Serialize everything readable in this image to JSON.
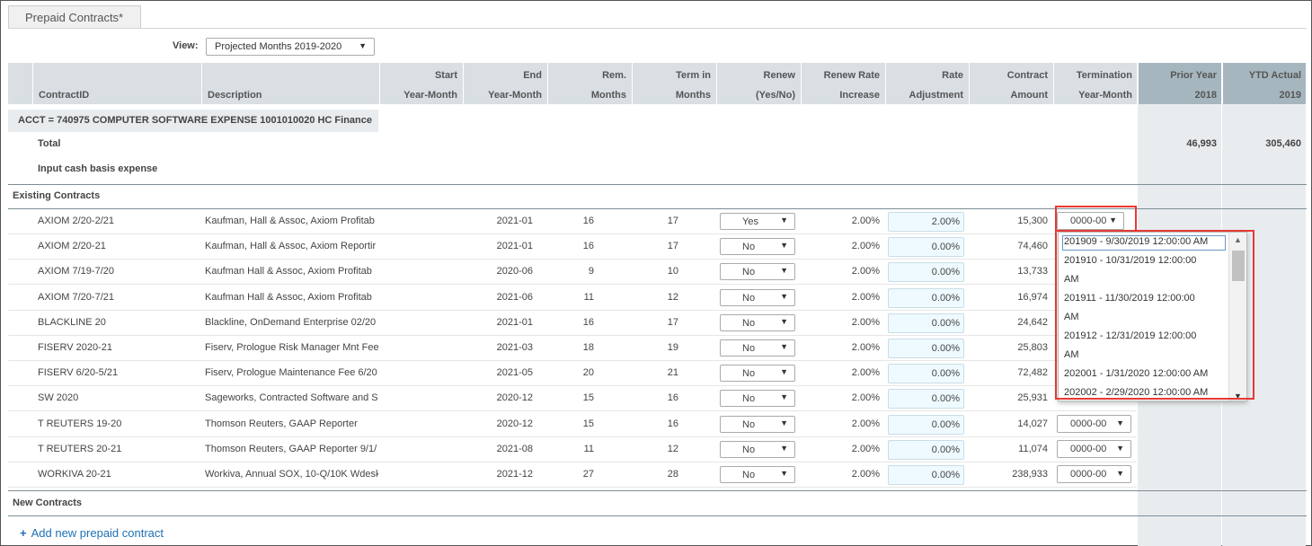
{
  "tab": {
    "label": "Prepaid Contracts*"
  },
  "view": {
    "label": "View:",
    "value": "Projected  Months 2019-2020"
  },
  "headers": {
    "contract_id": "ContractID",
    "description": "Description",
    "start_1": "Start",
    "start_2": "Year-Month",
    "end_1": "End",
    "end_2": "Year-Month",
    "rem_1": "Rem.",
    "rem_2": "Months",
    "term_1": "Term in",
    "term_2": "Months",
    "renew_1": "Renew",
    "renew_2": "(Yes/No)",
    "rri_1": "Renew Rate",
    "rri_2": "Increase",
    "adj_1": "Rate",
    "adj_2": "Adjustment",
    "amt_1": "Contract",
    "amt_2": "Amount",
    "tym_1": "Termination",
    "tym_2": "Year-Month",
    "prior_1": "Prior Year",
    "prior_2": "2018",
    "ytd_1": "YTD Actual",
    "ytd_2": "2019"
  },
  "account": {
    "title": "ACCT = 740975 COMPUTER SOFTWARE EXPENSE 1001010020 HC Finance",
    "total_label": "Total",
    "total_prior": "46,993",
    "total_ytd": "305,460",
    "input_label": "Input cash basis expense"
  },
  "sections": {
    "existing": "Existing Contracts",
    "new": "New Contracts"
  },
  "rows": [
    {
      "id": "AXIOM 2/20-2/21",
      "desc": "Kaufman, Hall & Assoc, Axiom Profitab",
      "end": "2021-01",
      "rem": "16",
      "term": "17",
      "renew": "Yes",
      "rri": "2.00%",
      "adj": "2.00%",
      "amt": "15,300",
      "tym": "0000-00"
    },
    {
      "id": "AXIOM 2/20-21",
      "desc": "Kaufman, Hall & Assoc, Axiom Reportir",
      "end": "2021-01",
      "rem": "16",
      "term": "17",
      "renew": "No",
      "rri": "2.00%",
      "adj": "0.00%",
      "amt": "74,460",
      "tym": ""
    },
    {
      "id": "AXIOM 7/19-7/20",
      "desc": "Kaufman Hall & Assoc, Axiom Profitab",
      "end": "2020-06",
      "rem": "9",
      "term": "10",
      "renew": "No",
      "rri": "2.00%",
      "adj": "0.00%",
      "amt": "13,733",
      "tym": ""
    },
    {
      "id": "AXIOM 7/20-7/21",
      "desc": "Kaufman Hall & Assoc, Axiom Profitab",
      "end": "2021-06",
      "rem": "11",
      "term": "12",
      "renew": "No",
      "rri": "2.00%",
      "adj": "0.00%",
      "amt": "16,974",
      "tym": ""
    },
    {
      "id": "BLACKLINE 20",
      "desc": "Blackline, OnDemand Enterprise 02/20",
      "end": "2021-01",
      "rem": "16",
      "term": "17",
      "renew": "No",
      "rri": "2.00%",
      "adj": "0.00%",
      "amt": "24,642",
      "tym": ""
    },
    {
      "id": "FISERV 2020-21",
      "desc": "Fiserv, Prologue Risk Manager Mnt Fee",
      "end": "2021-03",
      "rem": "18",
      "term": "19",
      "renew": "No",
      "rri": "2.00%",
      "adj": "0.00%",
      "amt": "25,803",
      "tym": ""
    },
    {
      "id": "FISERV 6/20-5/21",
      "desc": "Fiserv, Prologue Maintenance Fee 6/20",
      "end": "2021-05",
      "rem": "20",
      "term": "21",
      "renew": "No",
      "rri": "2.00%",
      "adj": "0.00%",
      "amt": "72,482",
      "tym": ""
    },
    {
      "id": "SW 2020",
      "desc": "Sageworks, Contracted Software and S",
      "end": "2020-12",
      "rem": "15",
      "term": "16",
      "renew": "No",
      "rri": "2.00%",
      "adj": "0.00%",
      "amt": "25,931",
      "tym": ""
    },
    {
      "id": "T REUTERS 19-20",
      "desc": "Thomson Reuters, GAAP Reporter",
      "end": "2020-12",
      "rem": "15",
      "term": "16",
      "renew": "No",
      "rri": "2.00%",
      "adj": "0.00%",
      "amt": "14,027",
      "tym": "0000-00"
    },
    {
      "id": "T REUTERS 20-21",
      "desc": "Thomson Reuters, GAAP Reporter 9/1/",
      "end": "2021-08",
      "rem": "11",
      "term": "12",
      "renew": "No",
      "rri": "2.00%",
      "adj": "0.00%",
      "amt": "11,074",
      "tym": "0000-00"
    },
    {
      "id": "WORKIVA 20-21",
      "desc": "Workiva, Annual SOX, 10-Q/10K Wdesk",
      "end": "2021-12",
      "rem": "27",
      "term": "28",
      "renew": "No",
      "rri": "2.00%",
      "adj": "0.00%",
      "amt": "238,933",
      "tym": "0000-00"
    }
  ],
  "dropdown_options": [
    "201909 - 9/30/2019 12:00:00 AM",
    "201910 - 10/31/2019 12:00:00",
    "AM",
    "201911 - 11/30/2019 12:00:00",
    "AM",
    "201912 - 12/31/2019 12:00:00",
    "AM",
    "202001 - 1/31/2020 12:00:00 AM",
    "202002 - 2/29/2020 12:00:00 AM"
  ],
  "add_link": "Add new prepaid contract",
  "colors": {
    "header": "#d9dfe3",
    "prior_header": "#a6b6be",
    "highlight": "#e53935",
    "link": "#1e6fb5"
  }
}
